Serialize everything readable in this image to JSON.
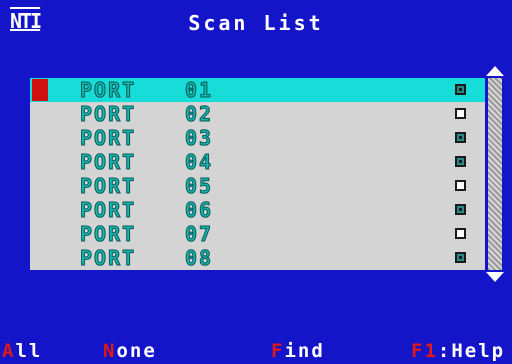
{
  "header": {
    "logo": "NTI",
    "title": "Scan List"
  },
  "colors": {
    "background": "#1414c8",
    "selected_row": "#17dcd8",
    "list_background": "#d4d4d4",
    "hotkey": "#e01818",
    "text": "#ffffff"
  },
  "list": {
    "rows": [
      {
        "label": "PORT",
        "number": "01",
        "checked": true,
        "selected": true
      },
      {
        "label": "PORT",
        "number": "02",
        "checked": false,
        "selected": false
      },
      {
        "label": "PORT",
        "number": "03",
        "checked": true,
        "selected": false
      },
      {
        "label": "PORT",
        "number": "04",
        "checked": true,
        "selected": false
      },
      {
        "label": "PORT",
        "number": "05",
        "checked": false,
        "selected": false
      },
      {
        "label": "PORT",
        "number": "06",
        "checked": true,
        "selected": false
      },
      {
        "label": "PORT",
        "number": "07",
        "checked": false,
        "selected": false
      },
      {
        "label": "PORT",
        "number": "08",
        "checked": true,
        "selected": false
      }
    ]
  },
  "scrollbar": {
    "up_icon": "arrow-up-icon",
    "down_icon": "arrow-down-icon"
  },
  "footer": {
    "all": {
      "hot": "A",
      "rest": "ll"
    },
    "none": {
      "hot": "N",
      "rest": "one"
    },
    "find": {
      "hot": "F",
      "rest": "ind"
    },
    "help": {
      "hot": "F1",
      "rest": ":Help"
    }
  }
}
